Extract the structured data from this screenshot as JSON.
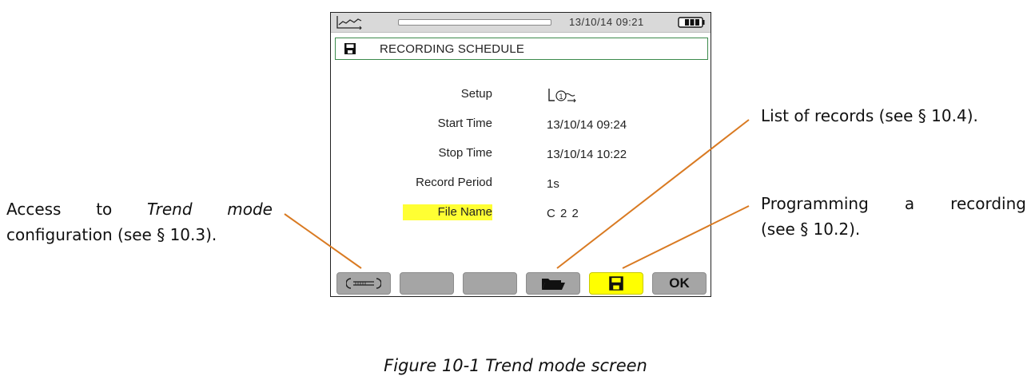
{
  "status_bar": {
    "datetime": "13/10/14 09:21",
    "progress_icon": "progress-bar",
    "mode_icon": "trend-icon",
    "battery_icon": "battery-icon"
  },
  "title": {
    "text": "RECORDING SCHEDULE",
    "icon": "floppy-disk-icon"
  },
  "fields": [
    {
      "label": "Setup",
      "value": ""
    },
    {
      "label": "Start Time",
      "value": "13/10/14 09:24"
    },
    {
      "label": "Stop Time",
      "value": "13/10/14 10:22"
    },
    {
      "label": "Record Period",
      "value": "1s"
    },
    {
      "label": "File Name",
      "value": "C 2 2"
    }
  ],
  "function_keys": {
    "f1_icon": "wrench-icon",
    "f4_icon": "open-folder-icon",
    "f5_icon": "floppy-disk-icon",
    "f6_label": "OK"
  },
  "callouts": {
    "trend_config_line1_words": [
      "Access",
      "to",
      "Trend",
      "mode"
    ],
    "trend_config_line2": "configuration (see § 10.3).",
    "list_of_records": "List of records (see § 10.4).",
    "programming_line1_words": [
      "Programming",
      "a",
      "recording"
    ],
    "programming_line2": "(see § 10.2)."
  },
  "caption": "Figure 10-1 Trend mode screen",
  "colors": {
    "highlight": "#ffff00",
    "title_border": "#3c8a4c",
    "callout_line": "#d97a22",
    "key_gray": "#a5a5a5"
  }
}
